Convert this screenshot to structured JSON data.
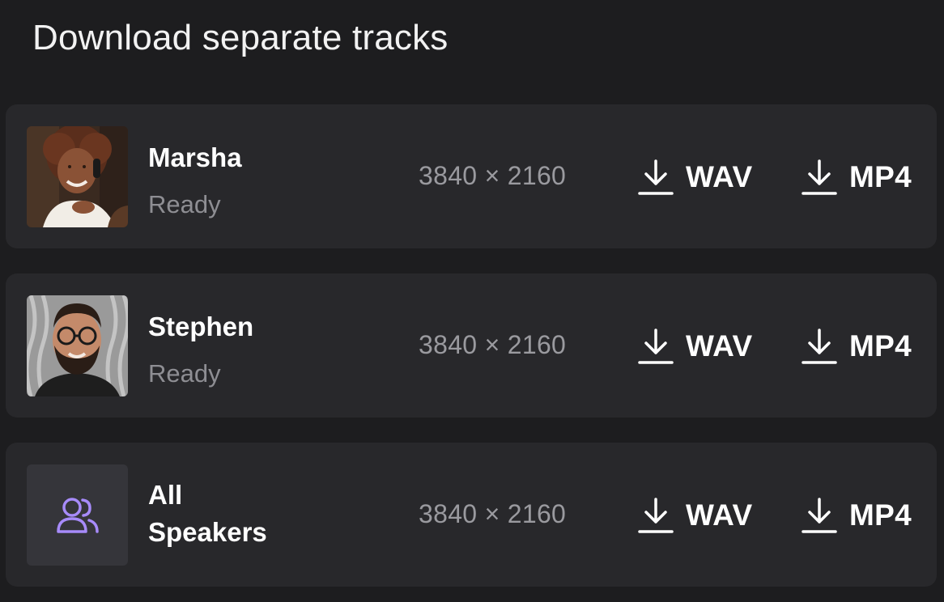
{
  "title": "Download separate tracks",
  "tracks": [
    {
      "name": "Marsha",
      "status": "Ready",
      "resolution": "3840 × 2160",
      "wav_label": "WAV",
      "mp4_label": "MP4",
      "avatar": "marsha-photo"
    },
    {
      "name": "Stephen",
      "status": "Ready",
      "resolution": "3840 × 2160",
      "wav_label": "WAV",
      "mp4_label": "MP4",
      "avatar": "stephen-photo"
    },
    {
      "name": "All Speakers",
      "resolution": "3840 × 2160",
      "wav_label": "WAV",
      "mp4_label": "MP4",
      "avatar": "users-icon"
    }
  ],
  "colors": {
    "background": "#1d1d1f",
    "card": "#28282b",
    "accent_icon": "#a78bfa",
    "muted_text": "#8e8e93"
  }
}
